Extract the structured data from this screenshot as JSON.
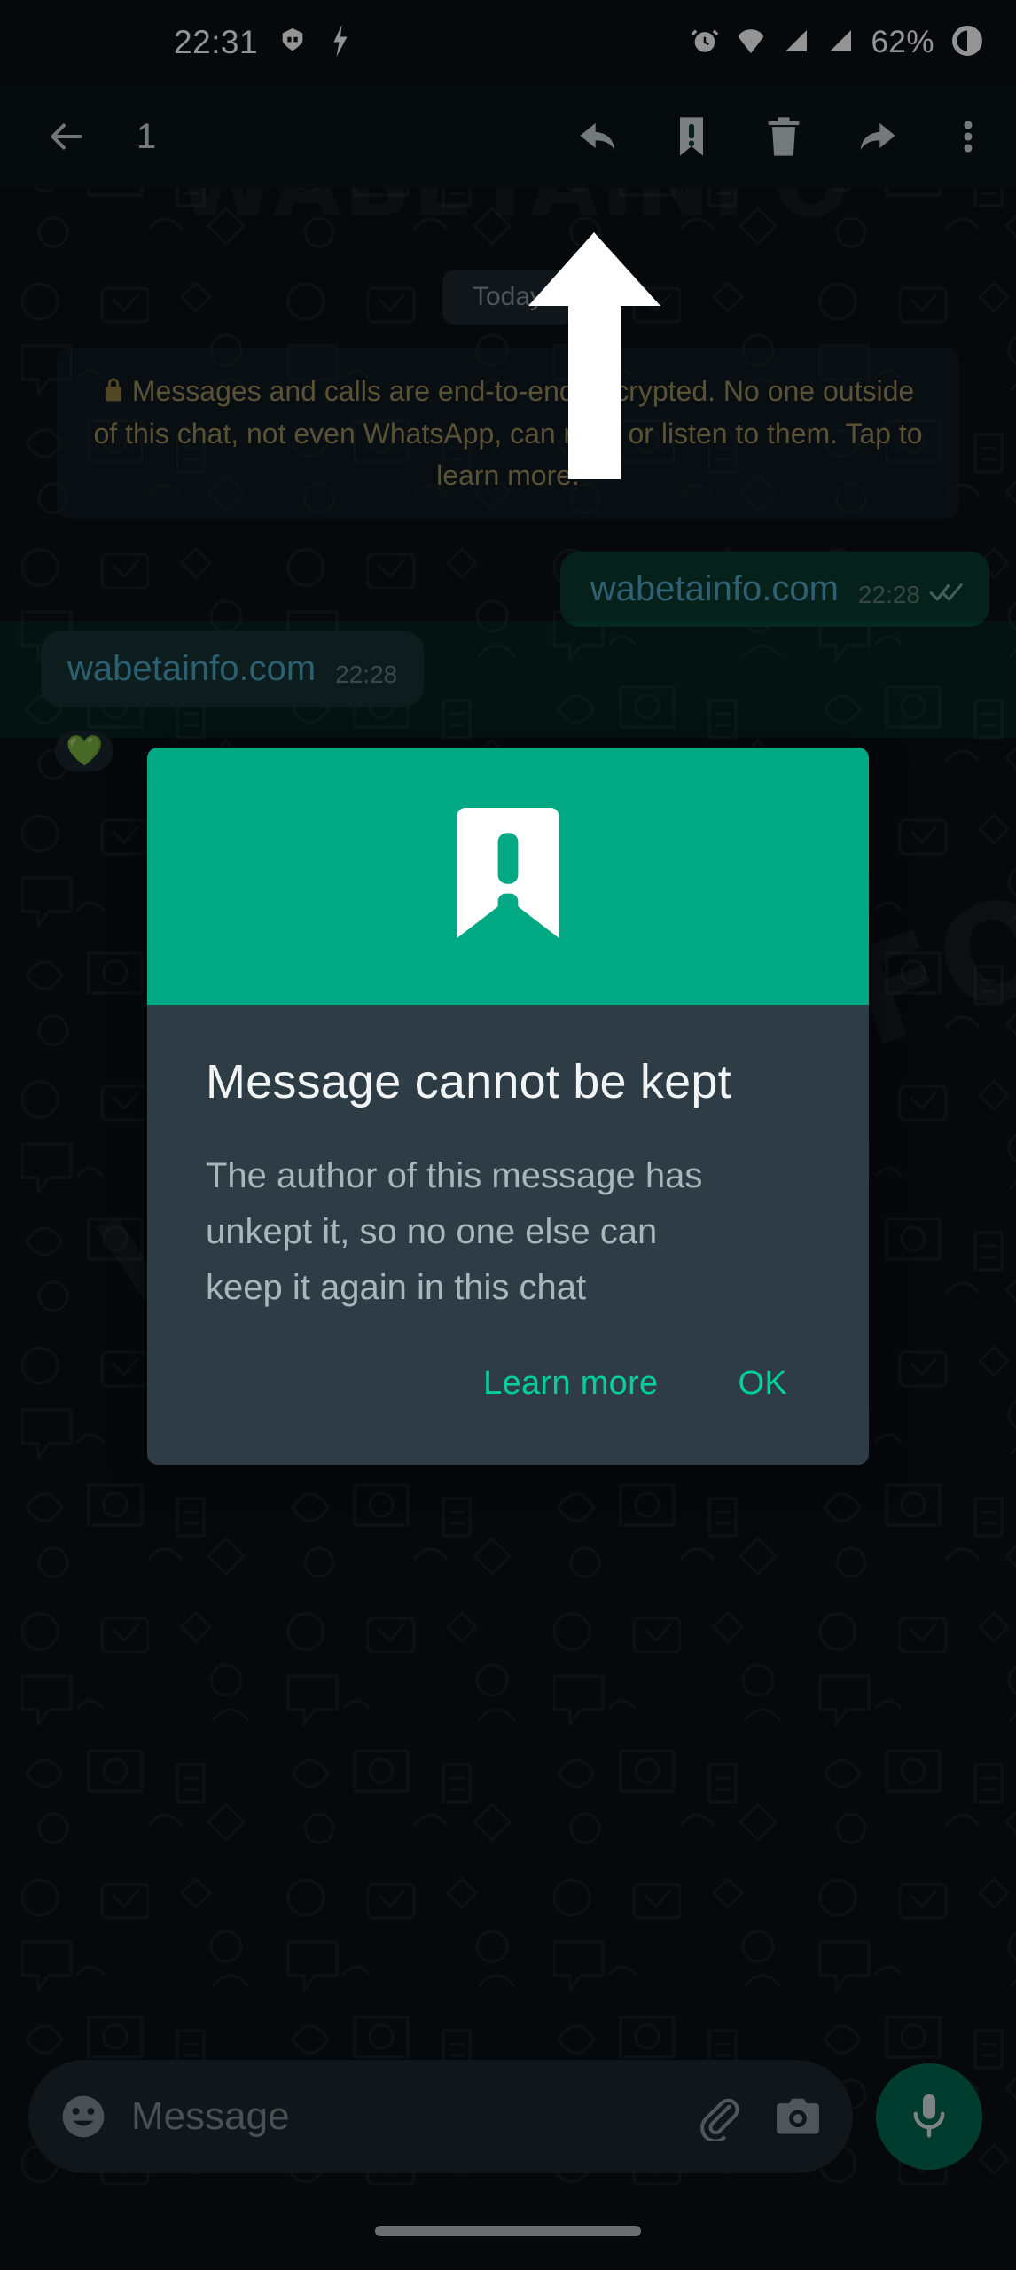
{
  "status_bar": {
    "time": "22:31",
    "battery_percent": "62%",
    "icons": [
      "vpn-key-icon",
      "bolt-icon",
      "alarm-icon",
      "wifi-icon",
      "signal-sim1-icon",
      "signal-sim2-icon",
      "battery-circle-icon"
    ]
  },
  "action_bar": {
    "back_icon": "arrow-back-icon",
    "selected_count": "1",
    "actions": [
      {
        "name": "reply-icon",
        "label": "Reply"
      },
      {
        "name": "keep-icon",
        "label": "Keep"
      },
      {
        "name": "delete-icon",
        "label": "Delete"
      },
      {
        "name": "forward-icon",
        "label": "Forward"
      },
      {
        "name": "overflow-menu-icon",
        "label": "More options"
      }
    ]
  },
  "chat": {
    "date_chip": "Today",
    "encryption_notice": "Messages and calls are end-to-end encrypted. No one outside of this chat, not even WhatsApp, can read or listen to them. Tap to learn more.",
    "messages": [
      {
        "direction": "outgoing",
        "text": "wabetainfo.com",
        "time": "22:28",
        "status": "read",
        "status_glyph": "double-check-icon"
      },
      {
        "direction": "incoming",
        "text": "wabetainfo.com",
        "time": "22:28",
        "selected": true,
        "reaction": "💚"
      }
    ]
  },
  "dialog": {
    "icon": "keep-bookmark-alert-icon",
    "title": "Message cannot be kept",
    "body": "The author of this message has unkept it, so no one else can keep it again in this chat",
    "buttons": [
      {
        "name": "learn-more-button",
        "label": "Learn more"
      },
      {
        "name": "ok-button",
        "label": "OK"
      }
    ]
  },
  "composer": {
    "placeholder": "Message",
    "emoji_icon": "emoji-icon",
    "attach_icon": "paperclip-icon",
    "camera_icon": "camera-icon",
    "mic_icon": "microphone-icon"
  },
  "watermark": {
    "text": "WABETAINFO"
  },
  "colors": {
    "accent_green": "#00A884",
    "dialog_body": "#2E3C46",
    "button_green": "#00D09C",
    "outgoing_bubble": "#0C3A2D",
    "incoming_bubble": "#1B262B",
    "chat_background": "#0B1116",
    "link_text": "#53A6C9",
    "encryption_text": "#9A8D5B"
  }
}
